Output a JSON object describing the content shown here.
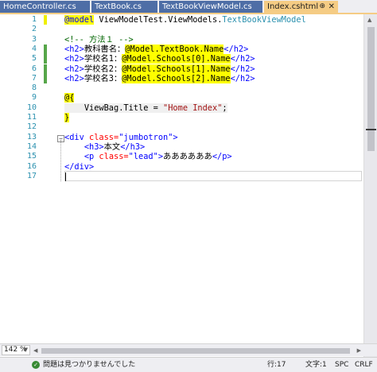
{
  "tabs": [
    {
      "label": "HomeController.cs",
      "active": false
    },
    {
      "label": "TextBook.cs",
      "active": false
    },
    {
      "label": "TextBookViewModel.cs",
      "active": false
    },
    {
      "label": "Index.cshtml",
      "active": true
    }
  ],
  "tab_pin_glyph": "⊕",
  "tab_close_glyph": "✕",
  "line_numbers": [
    "1",
    "2",
    "3",
    "4",
    "5",
    "6",
    "7",
    "8",
    "9",
    "10",
    "11",
    "12",
    "13",
    "14",
    "15",
    "16",
    "17"
  ],
  "code": {
    "l1_model_kw": "@model",
    "l1_ns": "ViewModelTest.ViewModels.",
    "l1_type": "TextBookViewModel",
    "l3_comment": "<!-- 方法１ -->",
    "l4_open": "<h2>",
    "l4_text": "教科書名：",
    "l4_expr": "@Model.TextBook.Name",
    "l4_close": "</h2>",
    "l5_open": "<h2>",
    "l5_text": "学校名1：",
    "l5_expr": "@Model.Schools[0].Name",
    "l5_close": "</h2>",
    "l6_open": "<h2>",
    "l6_text": "学校名2：",
    "l6_expr": "@Model.Schools[1].Name",
    "l6_close": "</h2>",
    "l7_open": "<h2>",
    "l7_text": "学校名3：",
    "l7_expr": "@Model.Schools[2].Name",
    "l7_close": "</h2>",
    "l9_open": "@{",
    "l10_code": "ViewBag.Title = ",
    "l10_str": "\"Home Index\"",
    "l10_end": ";",
    "l11_close": "}",
    "l13_tag": "<div",
    "l13_attr": " class=",
    "l13_val": "\"jumbotron\"",
    "l13_end": ">",
    "l14_open": "<h3>",
    "l14_text": "本文",
    "l14_close": "</h3>",
    "l15_tag": "<p",
    "l15_attr": " class=",
    "l15_val": "\"lead\"",
    "l15_gt": ">",
    "l15_text": "ああああああ",
    "l15_close": "</p>",
    "l16_close": "</div>"
  },
  "fold_glyph": "−",
  "zoom": {
    "value": "142 %",
    "dropdown_glyph": "▼"
  },
  "status": {
    "ok_icon_glyph": "✓",
    "message": "問題は見つかりませんでした",
    "line": "行:17",
    "char": "文字:1",
    "spc": "SPC",
    "crlf": "CRLF"
  },
  "scroll": {
    "up": "▲",
    "down": "▼",
    "left": "◀",
    "right": "▶"
  },
  "colors": {
    "tab_inactive": "#4e6ea6",
    "tab_active": "#f5cc84",
    "change_green": "#57a64a",
    "razor_yellow": "#ffff00"
  }
}
